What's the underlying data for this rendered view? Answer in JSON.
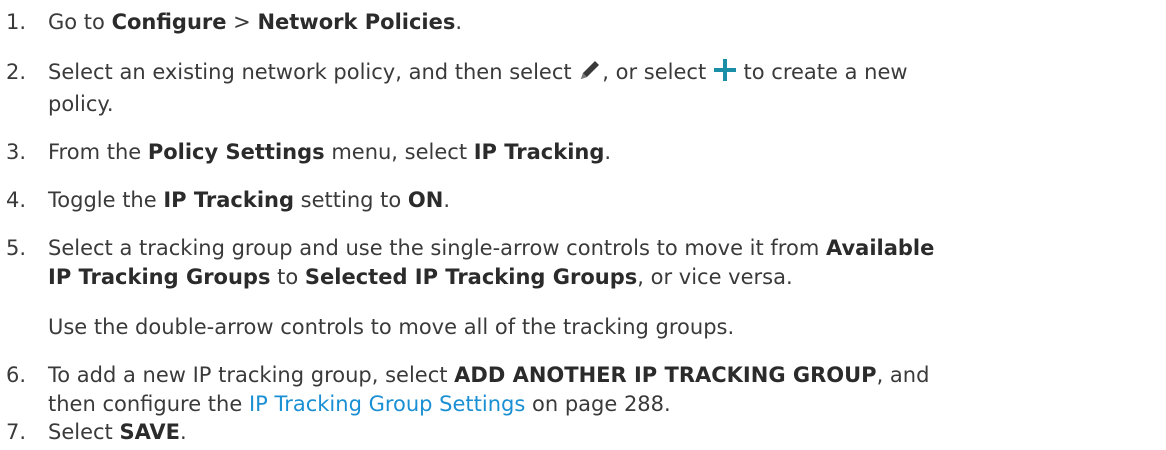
{
  "steps": [
    {
      "num": "1.",
      "t1": "Go to ",
      "b1": "Configure",
      "t2": " > ",
      "b2": "Network Policies",
      "t3": "."
    },
    {
      "num": "2.",
      "t1": "Select an existing network policy, and then select ",
      "icon1": "pencil-icon",
      "t2": ", or select ",
      "icon2": "plus-icon",
      "t3": " to create a new",
      "t4": "policy."
    },
    {
      "num": "3.",
      "t1": "From the ",
      "b1": "Policy Settings",
      "t2": " menu, select ",
      "b2": "IP Tracking",
      "t3": "."
    },
    {
      "num": "4.",
      "t1": "Toggle the ",
      "b1": "IP Tracking",
      "t2": " setting to ",
      "b2": "ON",
      "t3": "."
    },
    {
      "num": "5.",
      "t1": "Select a tracking group and use the single-arrow controls to move it from ",
      "b1": "Available",
      "b2": "IP Tracking Groups",
      "t2": " to ",
      "b3": "Selected IP Tracking Groups",
      "t3": ", or vice versa.",
      "note": "Use the double-arrow controls to move all of the tracking groups."
    },
    {
      "num": "6.",
      "t1": "To add a new IP tracking group, select ",
      "b1": "ADD ANOTHER IP TRACKING GROUP",
      "t2": ", and",
      "t3": "then configure the ",
      "link": "IP Tracking Group Settings",
      "t4": " on page 288."
    },
    {
      "num": "7.",
      "t1": "Select ",
      "b1": "SAVE",
      "t2": "."
    }
  ],
  "colors": {
    "text": "#3a3a3a",
    "link": "#1a8fd3",
    "plus_icon": "#1b8fa8",
    "pencil_icon": "#3a3a3a"
  }
}
